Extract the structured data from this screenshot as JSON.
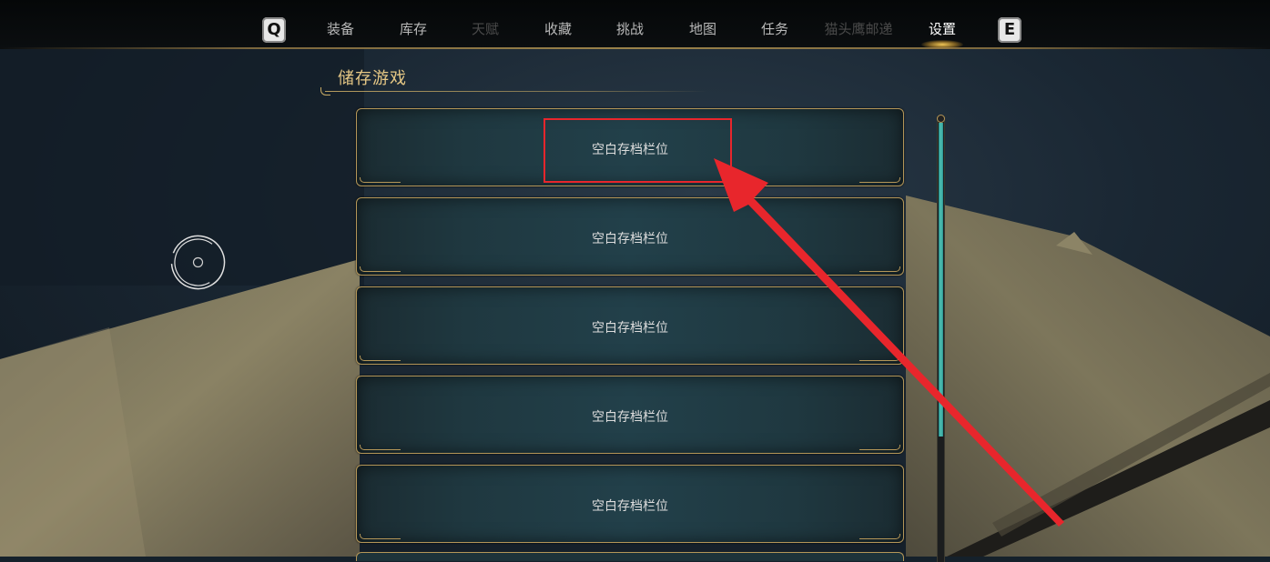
{
  "nav": {
    "left_key": "Q",
    "right_key": "E",
    "tabs": [
      {
        "label": "装备",
        "state": "normal"
      },
      {
        "label": "库存",
        "state": "normal"
      },
      {
        "label": "天赋",
        "state": "disabled"
      },
      {
        "label": "收藏",
        "state": "normal"
      },
      {
        "label": "挑战",
        "state": "normal"
      },
      {
        "label": "地图",
        "state": "normal"
      },
      {
        "label": "任务",
        "state": "normal"
      },
      {
        "label": "猫头鹰邮递",
        "state": "disabled"
      },
      {
        "label": "设置",
        "state": "active"
      }
    ]
  },
  "section": {
    "title": "储存游戏"
  },
  "slots": [
    {
      "label": "空白存档栏位"
    },
    {
      "label": "空白存档栏位"
    },
    {
      "label": "空白存档栏位"
    },
    {
      "label": "空白存档栏位"
    },
    {
      "label": "空白存档栏位"
    }
  ],
  "scrollbar": {
    "position": 0.0,
    "visible_fraction": 0.7
  },
  "annotation": {
    "box_color": "#e8262c",
    "arrow_color": "#e8262c",
    "target": "slot-1"
  },
  "colors": {
    "accent_gold": "#e6c885",
    "frame_gold": "#b49658",
    "scroll_teal": "#4fc3b7"
  }
}
